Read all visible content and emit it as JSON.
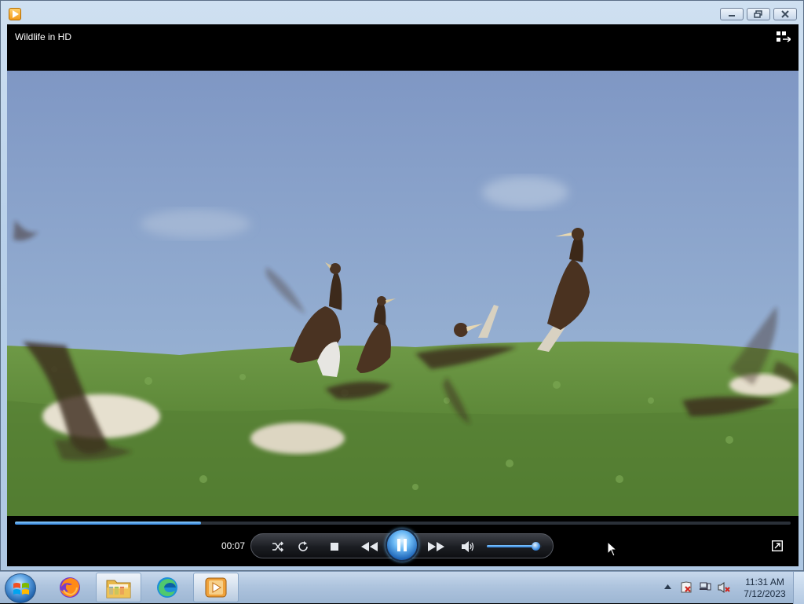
{
  "window": {
    "title": "Wildlife in HD"
  },
  "player": {
    "progress": 0.24,
    "time": "00:07",
    "state": "playing",
    "volume": 0.88
  },
  "icons": {
    "app": "media-player-icon",
    "switch": "switch-to-library-icon",
    "shuffle": "shuffle-icon",
    "repeat": "repeat-icon",
    "stop": "stop-icon",
    "previous": "rewind-icon",
    "play_pause": "pause-icon",
    "next": "fast-forward-icon",
    "mute": "speaker-icon",
    "fullscreen": "fullscreen-icon"
  },
  "taskbar": {
    "apps": [
      "Firefox",
      "Windows Explorer",
      "Microsoft Edge",
      "Windows Media Player"
    ],
    "clock_time": "11:31 AM",
    "clock_date": "7/12/2023"
  },
  "colors": {
    "accent": "#2e7fd8",
    "sky": "#8fa9cf",
    "grass": "#5c8a3a"
  }
}
